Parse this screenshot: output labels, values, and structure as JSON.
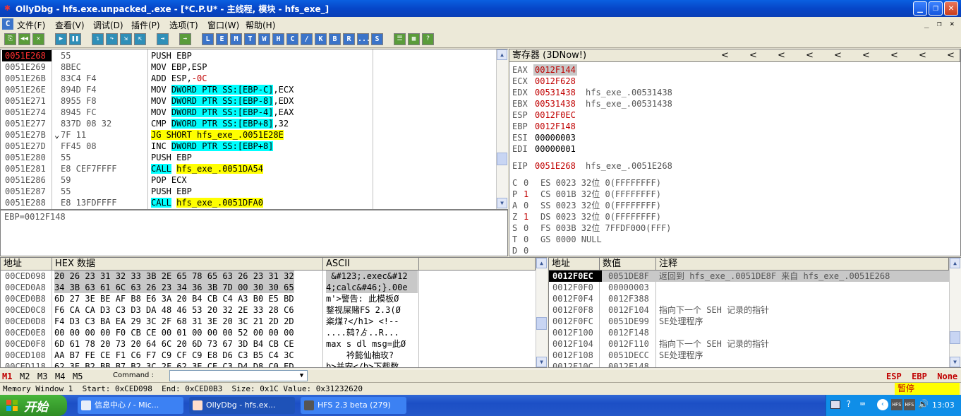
{
  "window": {
    "title": "OllyDbg - hfs.exe.unpacked_.exe - [*C.P.U* -  主线程, 模块 - hfs_exe_]",
    "btn_min": "_",
    "btn_max": "❐",
    "btn_close": "✕"
  },
  "menu": {
    "items": [
      "文件(F)",
      "查看(V)",
      "调试(D)",
      "插件(P)",
      "选项(T)",
      "窗口(W)",
      "帮助(H)"
    ],
    "mdi": [
      "_",
      "❐",
      "×"
    ]
  },
  "toolbar": {
    "letters": [
      "L",
      "E",
      "M",
      "T",
      "W",
      "H",
      "C",
      "/",
      "K",
      "B",
      "R",
      "...",
      "S"
    ]
  },
  "disasm": {
    "rows": [
      {
        "addr": "0051E268",
        "hex": "55",
        "mark": "",
        "inst": "PUSH EBP",
        "parts": []
      },
      {
        "addr": "0051E269",
        "hex": "8BEC",
        "mark": "",
        "inst": "MOV EBP,ESP",
        "parts": []
      },
      {
        "addr": "0051E26B",
        "hex": "83C4 F4",
        "mark": "",
        "pre": "ADD ESP,",
        "red": "-0C"
      },
      {
        "addr": "0051E26E",
        "hex": "894D F4",
        "mark": "",
        "pre": "MOV ",
        "cyan": "DWORD PTR SS:[EBP-C]",
        "post": ",ECX"
      },
      {
        "addr": "0051E271",
        "hex": "8955 F8",
        "mark": "",
        "pre": "MOV ",
        "cyan": "DWORD PTR SS:[EBP-8]",
        "post": ",EDX"
      },
      {
        "addr": "0051E274",
        "hex": "8945 FC",
        "mark": "",
        "pre": "MOV ",
        "cyan": "DWORD PTR SS:[EBP-4]",
        "post": ",EAX"
      },
      {
        "addr": "0051E277",
        "hex": "837D 08 32",
        "mark": "",
        "pre": "CMP ",
        "cyan": "DWORD PTR SS:[EBP+8]",
        "post": ",32"
      },
      {
        "addr": "0051E27B",
        "hex": "7F 11",
        "mark": "⌄",
        "yellow": "JG SHORT hfs_exe_.0051E28E"
      },
      {
        "addr": "0051E27D",
        "hex": "FF45 08",
        "mark": "",
        "pre": "INC ",
        "cyan": "DWORD PTR SS:[EBP+8]"
      },
      {
        "addr": "0051E280",
        "hex": "55",
        "mark": "",
        "inst": "PUSH EBP"
      },
      {
        "addr": "0051E281",
        "hex": "E8 CEF7FFFF",
        "mark": "",
        "cyan": "CALL",
        "post2": " ",
        "yellow": "hfs_exe_.0051DA54"
      },
      {
        "addr": "0051E286",
        "hex": "59",
        "mark": "",
        "inst": "POP ECX"
      },
      {
        "addr": "0051E287",
        "hex": "55",
        "mark": "",
        "inst": "PUSH EBP"
      },
      {
        "addr": "0051E288",
        "hex": "E8 13FDFFFF",
        "mark": "",
        "cyan": "CALL",
        "post2": " ",
        "yellow": "hfs_exe_.0051DFA0"
      }
    ],
    "info": "EBP=0012F148"
  },
  "registers": {
    "title": "寄存器 (3DNow!)",
    "arrows": [
      "<",
      "<",
      "<",
      "<",
      "<",
      "<",
      "<",
      "<",
      "<"
    ],
    "gp": [
      {
        "name": "EAX",
        "val": "0012F144",
        "note": "",
        "color": "red",
        "sel": true
      },
      {
        "name": "ECX",
        "val": "0012F628",
        "note": "",
        "color": "red"
      },
      {
        "name": "EDX",
        "val": "00531438",
        "note": "hfs_exe_.00531438",
        "color": "red"
      },
      {
        "name": "EBX",
        "val": "00531438",
        "note": "hfs_exe_.00531438",
        "color": "red"
      },
      {
        "name": "ESP",
        "val": "0012F0EC",
        "note": "",
        "color": "red"
      },
      {
        "name": "EBP",
        "val": "0012F148",
        "note": "",
        "color": "red"
      },
      {
        "name": "ESI",
        "val": "00000003",
        "note": "",
        "color": "black"
      },
      {
        "name": "EDI",
        "val": "00000001",
        "note": "",
        "color": "black"
      }
    ],
    "eip": {
      "name": "EIP",
      "val": "0051E268",
      "note": "hfs_exe_.0051E268"
    },
    "flags": [
      {
        "f": "C",
        "v": "0",
        "seg": "ES 0023 32位 0(FFFFFFFF)",
        "red": false
      },
      {
        "f": "P",
        "v": "1",
        "seg": "CS 001B 32位 0(FFFFFFFF)",
        "red": true
      },
      {
        "f": "A",
        "v": "0",
        "seg": "SS 0023 32位 0(FFFFFFFF)",
        "red": false
      },
      {
        "f": "Z",
        "v": "1",
        "seg": "DS 0023 32位 0(FFFFFFFF)",
        "red": true
      },
      {
        "f": "S",
        "v": "0",
        "seg": "FS 003B 32位 7FFDF000(FFF)",
        "red": false
      },
      {
        "f": "T",
        "v": "0",
        "seg": "GS 0000 NULL",
        "red": false
      },
      {
        "f": "D",
        "v": "0",
        "seg": "",
        "red": false
      }
    ]
  },
  "dump": {
    "headers": {
      "addr": "地址",
      "hex": "HEX 数据",
      "ascii": "ASCII"
    },
    "rows": [
      {
        "addr": "00CED098",
        "hex": "20 26 23 31 32 33 3B 2E 65 78 65 63 26 23 31 32",
        "ascii": " &#123;.exec&#12",
        "sel": true
      },
      {
        "addr": "00CED0A8",
        "hex": "34 3B 63 61 6C 63 26 23 34 36 3B 7D 00 30 30 65",
        "ascii": "4;calc&#46;}.00e",
        "sel": true
      },
      {
        "addr": "00CED0B8",
        "hex": "6D 27 3E BE AF B8 E6 3A 20 B4 CB C4 A3 B0 E5 BD",
        "ascii": "m'>警告: 此模板Ø"
      },
      {
        "addr": "00CED0C8",
        "hex": "F6 CA CA D3 C3 D3 DA 48 46 53 20 32 2E 33 28 C6",
        "ascii": "鍪视屎赌FS 2.3(Ø"
      },
      {
        "addr": "00CED0D8",
        "hex": "F4 D3 C3 BA EA 29 3C 2F 68 31 3E 20 3C 21 2D 2D",
        "ascii": "粢煤?</h1> <!--"
      },
      {
        "addr": "00CED0E8",
        "hex": "00 00 00 00 F0 CB CE 00 01 00 00 00 52 00 00 00",
        "ascii": "....鸫?ゟ..R..."
      },
      {
        "addr": "00CED0F8",
        "hex": "6D 61 78 20 73 20 64 6C 20 6D 73 67 3D B4 CB CE",
        "ascii": "max s dl msg=此Ø"
      },
      {
        "addr": "00CED108",
        "hex": "AA B7 FE CE F1 C6 F7 C9 CF C9 E8 D6 C3 B5 C4 3C",
        "ascii": "    衿懿仙柚玫?"
      },
      {
        "addr": "00CED118",
        "hex": "62 3E B2 BB B7 B2 3C 2F 62 3E CE C3 D4 D8 C0 ED",
        "ascii": "b>并安</b>下载数"
      }
    ]
  },
  "stack": {
    "headers": {
      "addr": "地址",
      "val": "数值",
      "note": "注释"
    },
    "rows": [
      {
        "addr": "0012F0EC",
        "val": "0051DE8F",
        "note": "返回到 hfs_exe_.0051DE8F 来自 hfs_exe_.0051E268",
        "sel": true
      },
      {
        "addr": "0012F0F0",
        "val": "00000003",
        "note": ""
      },
      {
        "addr": "0012F0F4",
        "val": "0012F388",
        "note": ""
      },
      {
        "addr": "0012F0F8",
        "val": "0012F104",
        "note": "指向下一个 SEH 记录的指针"
      },
      {
        "addr": "0012F0FC",
        "val": "0051DE99",
        "note": "SE处理程序"
      },
      {
        "addr": "0012F100",
        "val": "0012F148",
        "note": ""
      },
      {
        "addr": "0012F104",
        "val": "0012F110",
        "note": "指向下一个 SEH 记录的指针"
      },
      {
        "addr": "0012F108",
        "val": "0051DECC",
        "note": "SE处理程序"
      },
      {
        "addr": "0012F10C",
        "val": "0012F148",
        "note": ""
      }
    ]
  },
  "cmdbar": {
    "tabs": [
      "M1",
      "M2",
      "M3",
      "M4",
      "M5"
    ],
    "command_label": "Command :",
    "right": "ESP  EBP  None"
  },
  "statusbar": {
    "text": "Memory Window 1  Start: 0xCED098  End: 0xCED0B3  Size: 0x1C Value: 0x31232620",
    "state": "暂停"
  },
  "taskbar": {
    "start": "开始",
    "tasks": [
      "信息中心 / - Mic...",
      "OllyDbg - hfs.ex...",
      "HFS 2.3 beta (279)"
    ],
    "clock": "13:03"
  }
}
